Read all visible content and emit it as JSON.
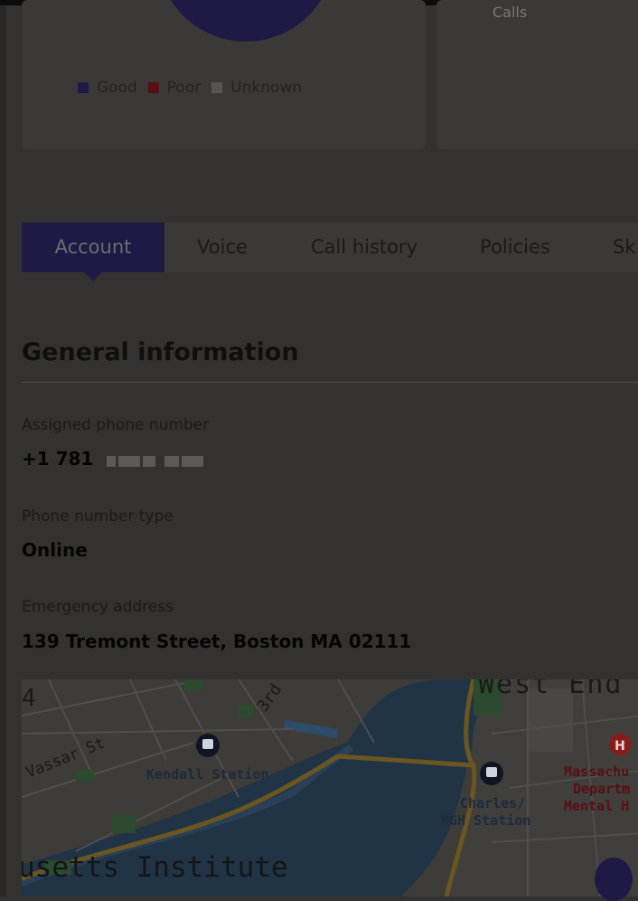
{
  "chart": {
    "partial_label": "Calls",
    "legend": [
      {
        "label": "Good",
        "color": "#1f1a45"
      },
      {
        "label": "Poor",
        "color": "#5a0f14"
      },
      {
        "label": "Unknown",
        "color": "#575553"
      }
    ]
  },
  "tabs": [
    {
      "label": "Account",
      "active": true
    },
    {
      "label": "Voice"
    },
    {
      "label": "Call history"
    },
    {
      "label": "Policies"
    },
    {
      "label": "Sk"
    }
  ],
  "general": {
    "title": "General information",
    "assigned_phone_label": "Assigned phone number",
    "assigned_phone_value": "+1 781",
    "phone_type_label": "Phone number type",
    "phone_type_value": "Online",
    "emergency_label": "Emergency address",
    "emergency_value": "139 Tremont Street, Boston MA 02111"
  },
  "map": {
    "labels": {
      "west_end": "West End",
      "number": "4",
      "street_3rd": "3rd",
      "vassar": "Vassar St",
      "kendall": "Kendall Station",
      "charles_1": "Charles/",
      "charles_2": "MGH Station",
      "mass_1": "Massachu",
      "mass_2": "Departm",
      "mass_3": "Mental H",
      "institute": "usetts Institute"
    },
    "colors": {
      "water": "#203446",
      "land": "#3d3c39",
      "highway": "#6b5620",
      "park": "#2b4a2f",
      "hospital": "#8b1a1a"
    }
  }
}
